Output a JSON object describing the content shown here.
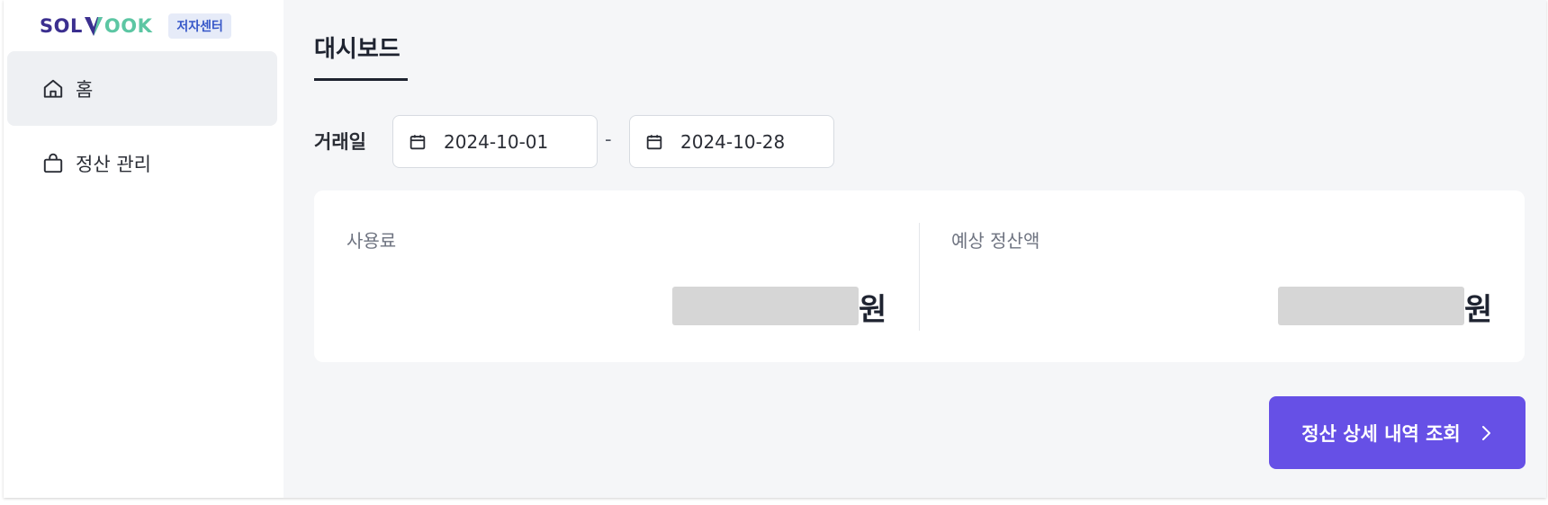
{
  "brand": {
    "logo_sol": "SOL",
    "logo_ook": "OOK",
    "badge": "저자센터"
  },
  "sidebar": {
    "items": [
      {
        "label": "홈",
        "icon": "home-icon",
        "active": true
      },
      {
        "label": "정산 관리",
        "icon": "shopping-bag-icon",
        "active": false
      }
    ]
  },
  "main": {
    "title": "대시보드",
    "filter": {
      "label": "거래일",
      "start_date": "2024-10-01",
      "end_date": "2024-10-28",
      "separator": "-"
    },
    "metrics": [
      {
        "label": "사용료",
        "unit": "원"
      },
      {
        "label": "예상 정산액",
        "unit": "원"
      }
    ],
    "cta_label": "정산 상세 내역 조회"
  },
  "colors": {
    "accent": "#6650e6",
    "brand_dark": "#3b2f8f",
    "brand_green": "#5cc6a3",
    "badge_bg": "#e6ebf8",
    "badge_text": "#3657c8"
  }
}
